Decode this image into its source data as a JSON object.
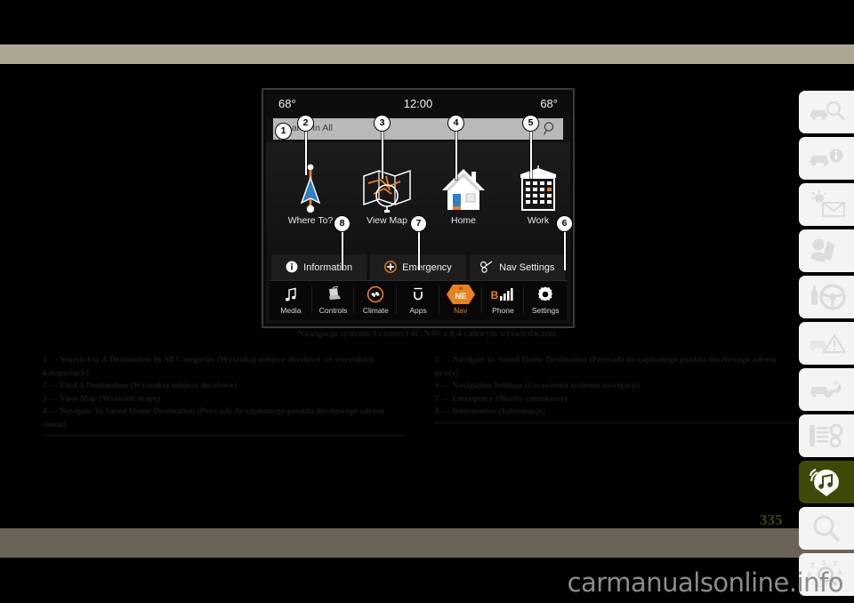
{
  "page": {
    "number": "335",
    "watermark": "carmanualsonline.info",
    "caption": "Nawigacja systemu Uconnect 4C NAV z 8,4-calowym wyświetlaczem"
  },
  "head_unit": {
    "status": {
      "temp_left": "68°",
      "clock": "12:00",
      "temp_right": "68°"
    },
    "search": {
      "placeholder": "Search In All",
      "icon": "search-icon"
    },
    "tiles": [
      {
        "label": "Where To?",
        "icon": "navigation-arrow-icon"
      },
      {
        "label": "View Map",
        "icon": "folded-map-icon"
      },
      {
        "label": "Home",
        "icon": "house-icon"
      },
      {
        "label": "Work",
        "icon": "office-building-icon"
      }
    ],
    "pills": [
      {
        "label": "Information",
        "icon": "info-circle-icon"
      },
      {
        "label": "Emergency",
        "icon": "plus-circle-icon"
      },
      {
        "label": "Nav Settings",
        "icon": "wrench-key-icon"
      }
    ],
    "taskbar": [
      {
        "label": "Media",
        "icon": "music-note-icon",
        "selected": false
      },
      {
        "label": "Controls",
        "icon": "seat-icon",
        "selected": false
      },
      {
        "label": "Climate",
        "icon": "fan-icon",
        "selected": false
      },
      {
        "label": "Apps",
        "icon": "uconnect-u-icon",
        "selected": false
      },
      {
        "label": "Nav",
        "icon": "compass-ne-icon",
        "selected": true
      },
      {
        "label": "Phone",
        "icon": "signal-bars-icon",
        "selected": false
      },
      {
        "label": "Settings",
        "icon": "gear-icon",
        "selected": false
      }
    ]
  },
  "callouts": [
    {
      "n": "1"
    },
    {
      "n": "2"
    },
    {
      "n": "3"
    },
    {
      "n": "4"
    },
    {
      "n": "5"
    },
    {
      "n": "6"
    },
    {
      "n": "7"
    },
    {
      "n": "8"
    }
  ],
  "legend_left": [
    "1 — Search For A Destination In All Categories (Wyszukaj miejsce docelowe we wszystkich kategoriach)",
    "2 — Find A Destination (Wyszukaj miejsce docelowe)",
    "3 — View Map (Wyświetl mapę)",
    "4 — Navigate To Saved Home Destination (Prowadź do zapisanego punktu docelowego adresu domu)"
  ],
  "legend_right": [
    "5 — Navigate To Saved Home Destination (Prowadź do zapisanego punktu docelowego adresu pracy)",
    "6 — Navigation Settings (Ustawienia systemu nawigacji)",
    "7 — Emergency (Służby ratunkowe)",
    "8 — Information (Informacje)"
  ],
  "sidebar_tabs": [
    {
      "icon": "car-inspect-icon",
      "active": false
    },
    {
      "icon": "car-info-icon",
      "active": false
    },
    {
      "icon": "climate-mail-icon",
      "active": false
    },
    {
      "icon": "seatbelt-icon",
      "active": false
    },
    {
      "icon": "steering-wheel-icon",
      "active": false
    },
    {
      "icon": "car-warning-icon",
      "active": false
    },
    {
      "icon": "car-service-icon",
      "active": false
    },
    {
      "icon": "specs-gear-icon",
      "active": false
    },
    {
      "icon": "multimedia-nav-icon",
      "active": true
    },
    {
      "icon": "search-icon",
      "active": false
    },
    {
      "icon": "index-abc-icon",
      "active": false
    }
  ],
  "colors": {
    "band_top": "#aea694",
    "band_bottom": "#6b6355",
    "accent_orange": "#e8821e",
    "active_tab": "#3d4a0a"
  }
}
